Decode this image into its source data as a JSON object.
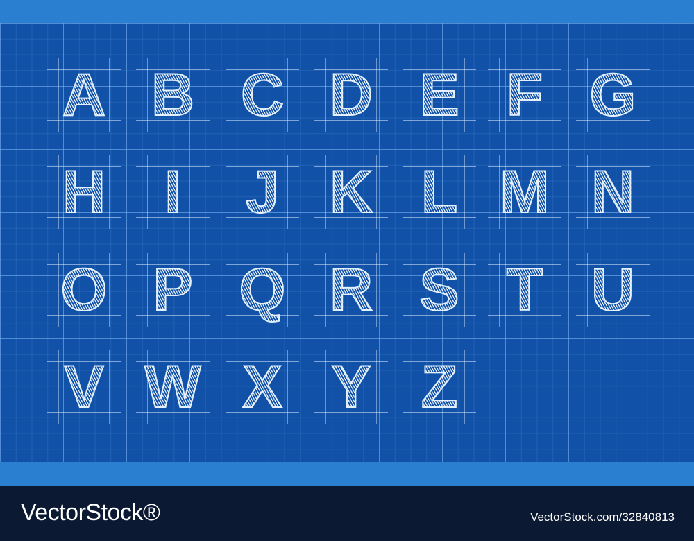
{
  "alphabet": {
    "row1": [
      "A",
      "B",
      "C",
      "D",
      "E",
      "F",
      "G"
    ],
    "row2": [
      "H",
      "I",
      "J",
      "K",
      "L",
      "M",
      "N"
    ],
    "row3": [
      "O",
      "P",
      "Q",
      "R",
      "S",
      "T",
      "U"
    ],
    "row4": [
      "V",
      "W",
      "X",
      "Y",
      "Z"
    ]
  },
  "footer": {
    "brand": "VectorStock®",
    "image_id": "VectorStock.com/32840813"
  },
  "colors": {
    "blueprint": "#1152a8",
    "frame": "#2a7fd0",
    "footer": "#0b1933",
    "ink": "#f0f6ff"
  }
}
